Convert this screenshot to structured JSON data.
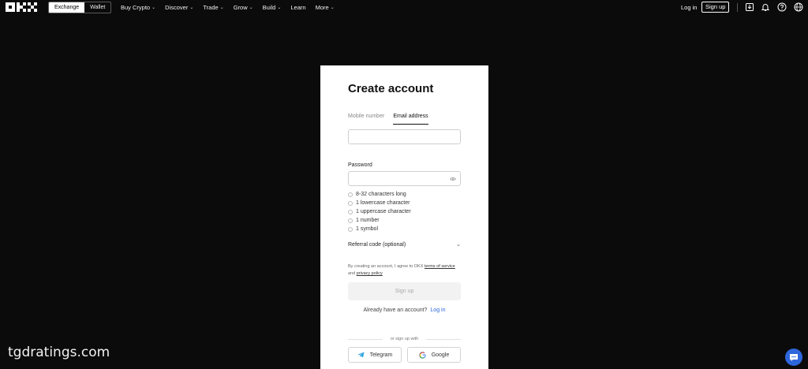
{
  "topbar": {
    "modes": [
      "Exchange",
      "Wallet"
    ],
    "nav": [
      {
        "label": "Buy Crypto",
        "dropdown": true
      },
      {
        "label": "Discover",
        "dropdown": true
      },
      {
        "label": "Trade",
        "dropdown": true
      },
      {
        "label": "Grow",
        "dropdown": true
      },
      {
        "label": "Build",
        "dropdown": true
      },
      {
        "label": "Learn",
        "dropdown": false
      },
      {
        "label": "More",
        "dropdown": true
      }
    ],
    "login": "Log in",
    "signup": "Sign up",
    "icons": [
      "download-icon",
      "bell-icon",
      "help-icon",
      "globe-icon"
    ]
  },
  "form": {
    "title": "Create account",
    "tabs": [
      "Mobile number",
      "Email address"
    ],
    "active_tab": "Email address",
    "email_value": "",
    "password_label": "Password",
    "password_value": "",
    "rules": [
      "8-32 characters long",
      "1 lowercase character",
      "1 uppercase character",
      "1 number",
      "1 symbol"
    ],
    "referral": "Referral code (optional)",
    "terms_prefix": "By creating an account, I agree to OKX",
    "terms_link": "terms of service",
    "terms_and": "and",
    "privacy_link": "privacy policy",
    "signup_button": "Sign up",
    "already_text": "Already have an account?",
    "login_link": "Log in",
    "or_text": "or sign up with",
    "social": [
      "Telegram",
      "Google"
    ]
  },
  "watermark": "tgdratings.com",
  "colors": {
    "accent": "#2e66db",
    "background": "#0b0b0b",
    "telegram": "#2aa3df"
  }
}
